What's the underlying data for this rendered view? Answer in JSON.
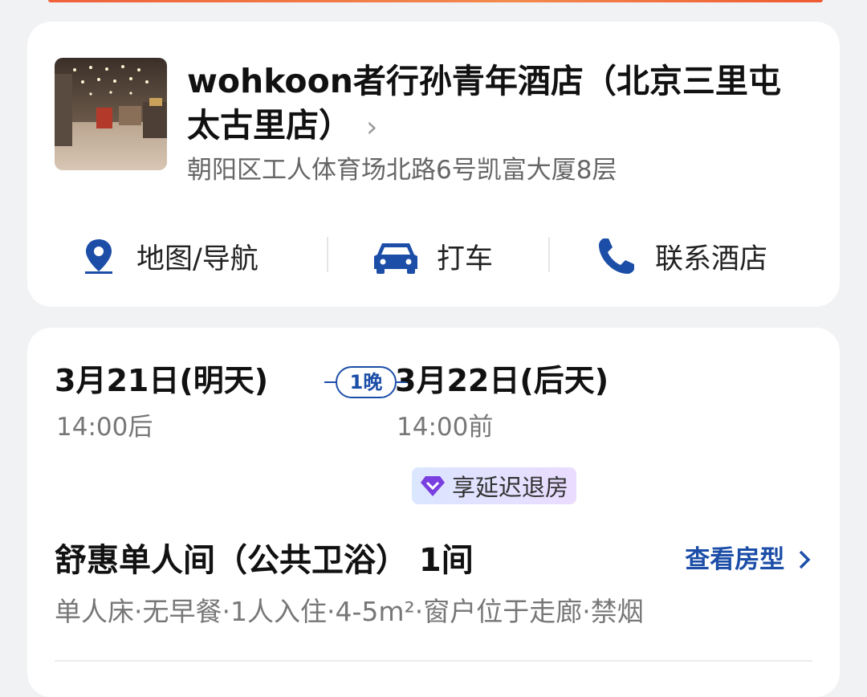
{
  "hotel": {
    "name": "wohkoon者行孙青年酒店（北京三里屯太古里店）",
    "chevron": "›",
    "address": "朝阳区工人体育场北路6号凯富大厦8层",
    "actions": [
      {
        "label": "地图/导航",
        "icon": "map-pin-icon"
      },
      {
        "label": "打车",
        "icon": "car-icon"
      },
      {
        "label": "联系酒店",
        "icon": "phone-icon"
      }
    ]
  },
  "booking": {
    "checkin_date": "3月21日(明天)",
    "checkin_time": "14:00后",
    "nights": "1晚",
    "checkout_date": "3月22日(后天)",
    "checkout_time": "14:00前",
    "benefit_badge": "享延迟退房",
    "room_name": "舒惠单人间（公共卫浴） 1间",
    "view_room_label": "查看房型",
    "room_meta": "单人床·无早餐·1人入住·4-5m²·窗户位于走廊·禁烟"
  },
  "colors": {
    "accent": "#1c4ea8",
    "top_strip": "#f0623a",
    "badge_gradient_start": "#dbe6ff",
    "badge_gradient_end": "#eadcff"
  }
}
